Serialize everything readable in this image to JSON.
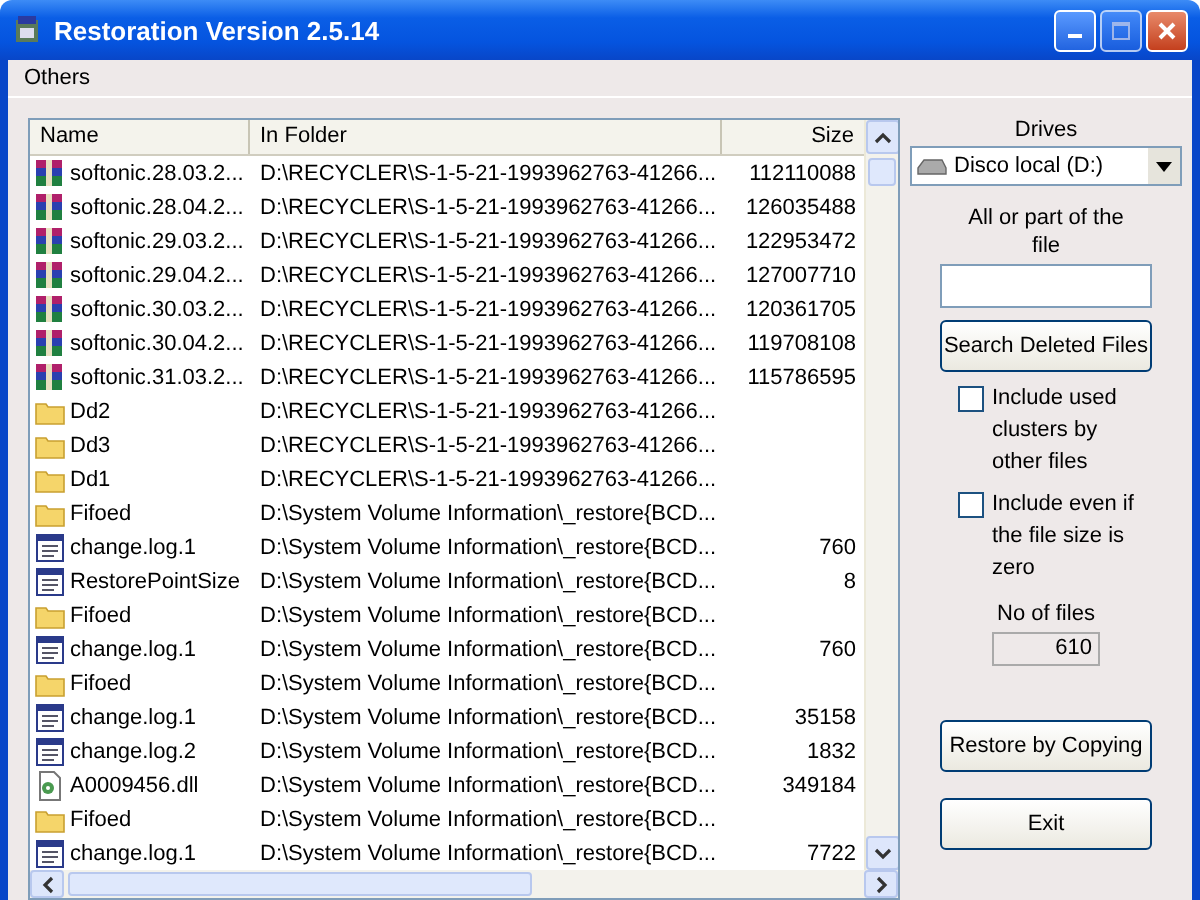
{
  "window": {
    "title": "Restoration Version 2.5.14"
  },
  "menu": [
    "Others"
  ],
  "table": {
    "columns": [
      "Name",
      "In Folder",
      "Size"
    ],
    "rows": [
      {
        "kind": "archive",
        "name": "softonic.28.03.2...",
        "folder": "D:\\RECYCLER\\S-1-5-21-1993962763-41266...",
        "size": "112110088"
      },
      {
        "kind": "archive",
        "name": "softonic.28.04.2...",
        "folder": "D:\\RECYCLER\\S-1-5-21-1993962763-41266...",
        "size": "126035488"
      },
      {
        "kind": "archive",
        "name": "softonic.29.03.2...",
        "folder": "D:\\RECYCLER\\S-1-5-21-1993962763-41266...",
        "size": "122953472"
      },
      {
        "kind": "archive",
        "name": "softonic.29.04.2...",
        "folder": "D:\\RECYCLER\\S-1-5-21-1993962763-41266...",
        "size": "127007710"
      },
      {
        "kind": "archive",
        "name": "softonic.30.03.2...",
        "folder": "D:\\RECYCLER\\S-1-5-21-1993962763-41266...",
        "size": "120361705"
      },
      {
        "kind": "archive",
        "name": "softonic.30.04.2...",
        "folder": "D:\\RECYCLER\\S-1-5-21-1993962763-41266...",
        "size": "119708108"
      },
      {
        "kind": "archive",
        "name": "softonic.31.03.2...",
        "folder": "D:\\RECYCLER\\S-1-5-21-1993962763-41266...",
        "size": "115786595"
      },
      {
        "kind": "folder",
        "name": "Dd2",
        "folder": "D:\\RECYCLER\\S-1-5-21-1993962763-41266..."
      },
      {
        "kind": "folder",
        "name": "Dd3",
        "folder": "D:\\RECYCLER\\S-1-5-21-1993962763-41266..."
      },
      {
        "kind": "folder",
        "name": "Dd1",
        "folder": "D:\\RECYCLER\\S-1-5-21-1993962763-41266..."
      },
      {
        "kind": "folder",
        "name": "Fifoed",
        "folder": "D:\\System Volume Information\\_restore{BCD..."
      },
      {
        "kind": "file",
        "name": "change.log.1",
        "folder": "D:\\System Volume Information\\_restore{BCD...",
        "size": "760"
      },
      {
        "kind": "file",
        "name": "RestorePointSize",
        "folder": "D:\\System Volume Information\\_restore{BCD...",
        "size": "8"
      },
      {
        "kind": "folder",
        "name": "Fifoed",
        "folder": "D:\\System Volume Information\\_restore{BCD..."
      },
      {
        "kind": "file",
        "name": "change.log.1",
        "folder": "D:\\System Volume Information\\_restore{BCD...",
        "size": "760"
      },
      {
        "kind": "folder",
        "name": "Fifoed",
        "folder": "D:\\System Volume Information\\_restore{BCD..."
      },
      {
        "kind": "file",
        "name": "change.log.1",
        "folder": "D:\\System Volume Information\\_restore{BCD...",
        "size": "35158"
      },
      {
        "kind": "file",
        "name": "change.log.2",
        "folder": "D:\\System Volume Information\\_restore{BCD...",
        "size": "1832"
      },
      {
        "kind": "dll",
        "name": "A0009456.dll",
        "folder": "D:\\System Volume Information\\_restore{BCD...",
        "size": "349184"
      },
      {
        "kind": "folder",
        "name": "Fifoed",
        "folder": "D:\\System Volume Information\\_restore{BCD..."
      },
      {
        "kind": "file",
        "name": "change.log.1",
        "folder": "D:\\System Volume Information\\_restore{BCD...",
        "size": "7722"
      }
    ]
  },
  "panel": {
    "drives_label": "Drives",
    "drive": "Disco local (D:)",
    "search_label": "All or part of the file",
    "search_button": "Search Deleted Files",
    "options": [
      {
        "label": "Include used clusters by other files",
        "checked": false
      },
      {
        "label": "Include even if the file size is zero",
        "checked": false
      }
    ],
    "count_label": "No of files",
    "count": "610",
    "restore_button": "Restore by Copying",
    "exit_button": "Exit"
  }
}
